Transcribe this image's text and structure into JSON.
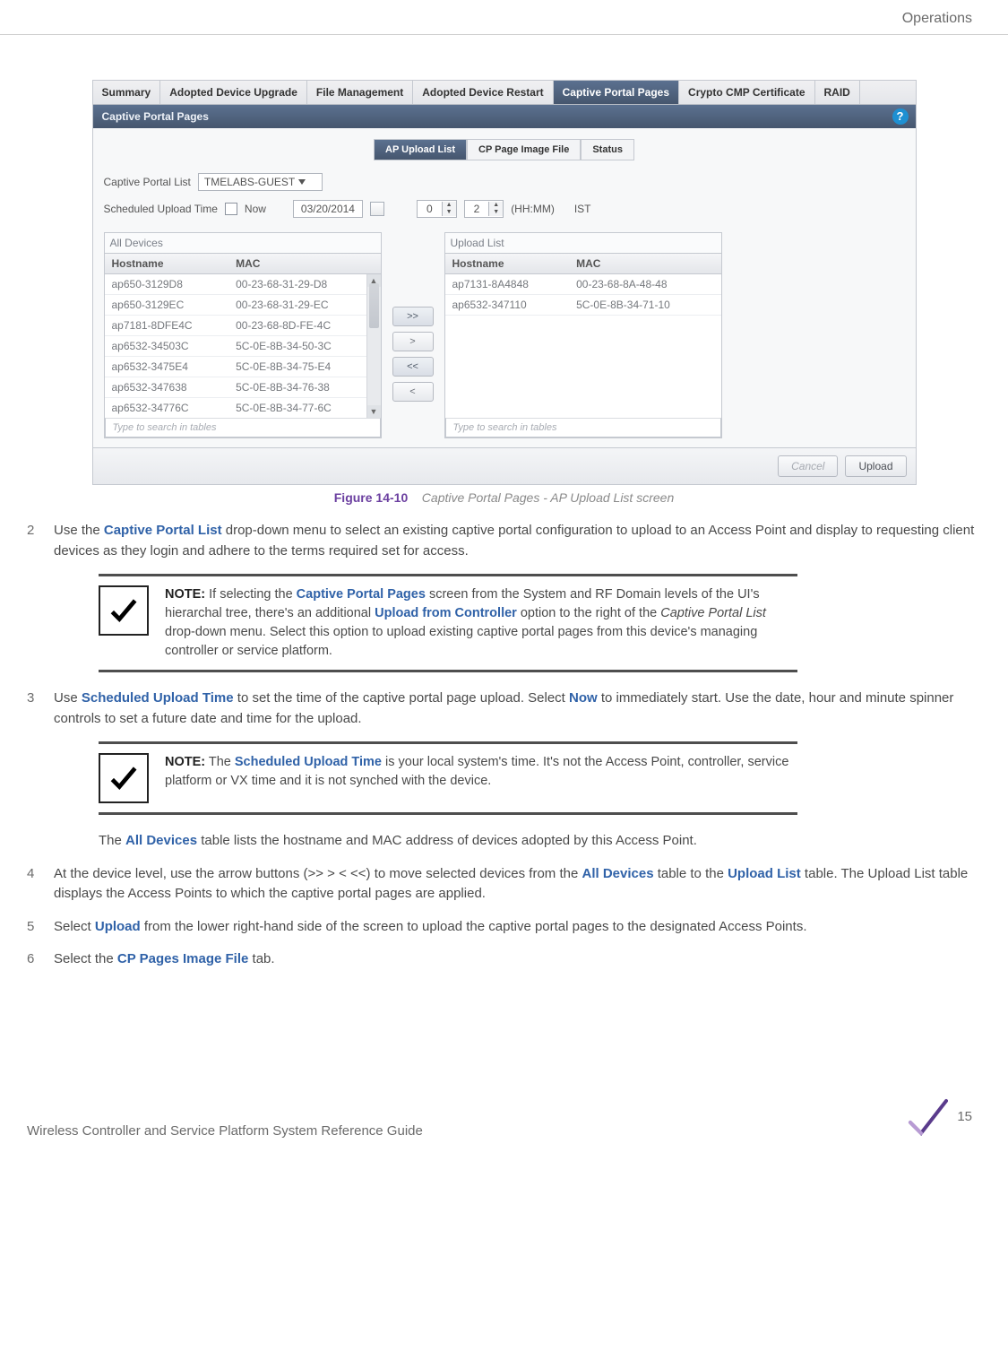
{
  "header": {
    "section": "Operations"
  },
  "screenshot": {
    "tabs": [
      "Summary",
      "Adopted Device Upgrade",
      "File Management",
      "Adopted Device Restart",
      "Captive Portal Pages",
      "Crypto CMP Certificate",
      "RAID"
    ],
    "active_tab_index": 4,
    "panel_title": "Captive Portal Pages",
    "inner_tabs": [
      "AP Upload List",
      "CP Page Image File",
      "Status"
    ],
    "inner_active_index": 0,
    "captive_portal_list_label": "Captive Portal List",
    "captive_portal_list_value": "TMELABS-GUEST",
    "scheduled_label": "Scheduled Upload Time",
    "now_label": "Now",
    "date_value": "03/20/2014",
    "hour_value": "0",
    "minute_value": "2",
    "time_format": "(HH:MM)",
    "tz": "IST",
    "all_devices_title": "All Devices",
    "upload_list_title": "Upload List",
    "col_hostname": "Hostname",
    "col_mac": "MAC",
    "all_devices_rows": [
      {
        "hostname": "ap650-3129D8",
        "mac": "00-23-68-31-29-D8"
      },
      {
        "hostname": "ap650-3129EC",
        "mac": "00-23-68-31-29-EC"
      },
      {
        "hostname": "ap7181-8DFE4C",
        "mac": "00-23-68-8D-FE-4C"
      },
      {
        "hostname": "ap6532-34503C",
        "mac": "5C-0E-8B-34-50-3C"
      },
      {
        "hostname": "ap6532-3475E4",
        "mac": "5C-0E-8B-34-75-E4"
      },
      {
        "hostname": "ap6532-347638",
        "mac": "5C-0E-8B-34-76-38"
      },
      {
        "hostname": "ap6532-34776C",
        "mac": "5C-0E-8B-34-77-6C"
      }
    ],
    "upload_list_rows": [
      {
        "hostname": "ap7131-8A4848",
        "mac": "00-23-68-8A-48-48"
      },
      {
        "hostname": "ap6532-347110",
        "mac": "5C-0E-8B-34-71-10"
      }
    ],
    "shuttle_buttons": [
      ">>",
      ">",
      "<<",
      "<"
    ],
    "search_placeholder": "Type to search in tables",
    "cancel_label": "Cancel",
    "upload_label": "Upload"
  },
  "figure": {
    "label": "Figure 14-10",
    "text": "Captive Portal Pages - AP Upload List screen"
  },
  "steps": {
    "s2_pre": "Use the ",
    "s2_link": "Captive Portal List",
    "s2_post": " drop-down menu to select an existing captive portal configuration to upload to an Access Point and display to requesting client devices as they login and adhere to the terms required set for access.",
    "s3_a": "Use ",
    "s3_link1": "Scheduled Upload Time",
    "s3_b": " to set the time of the captive portal page upload. Select ",
    "s3_link2": "Now",
    "s3_c": " to immediately start. Use the date, hour and minute spinner controls to set a future date and time for the upload.",
    "indented_a": "The ",
    "indented_link": "All Devices",
    "indented_b": " table lists the hostname and MAC address of devices adopted by this Access Point.",
    "s4_a": "At the device level, use the arrow buttons (>>  >  < <<) to move selected devices from the ",
    "s4_link1": "All Devices",
    "s4_b": " table to the ",
    "s4_link2": "Upload List",
    "s4_c": " table. The Upload List table displays the Access Points to which the captive portal pages are applied.",
    "s5_a": "Select ",
    "s5_link": "Upload",
    "s5_b": " from the lower right-hand side of the screen to upload the captive portal pages to the designated Access Points.",
    "s6_a": "Select the ",
    "s6_link": "CP Pages Image File",
    "s6_b": " tab."
  },
  "note1": {
    "label": "NOTE:",
    "t1": " If selecting the ",
    "l1": "Captive Portal Pages",
    "t2": " screen from the System and RF Domain levels of the UI's hierarchal tree, there's an additional ",
    "l2": "Upload from Controller",
    "t3": " option to the right of the ",
    "i1": "Captive Portal List",
    "t4": " drop-down menu. Select this option to upload existing captive portal pages from this device's managing controller or service platform."
  },
  "note2": {
    "label": "NOTE:",
    "t1": " The ",
    "l1": "Scheduled Upload Time",
    "t2": " is your local system's time. It's not the Access Point, controller, service platform or VX time and it is not synched with the device."
  },
  "footer": {
    "text": "Wireless Controller and Service Platform System Reference Guide",
    "page_number": "15"
  }
}
